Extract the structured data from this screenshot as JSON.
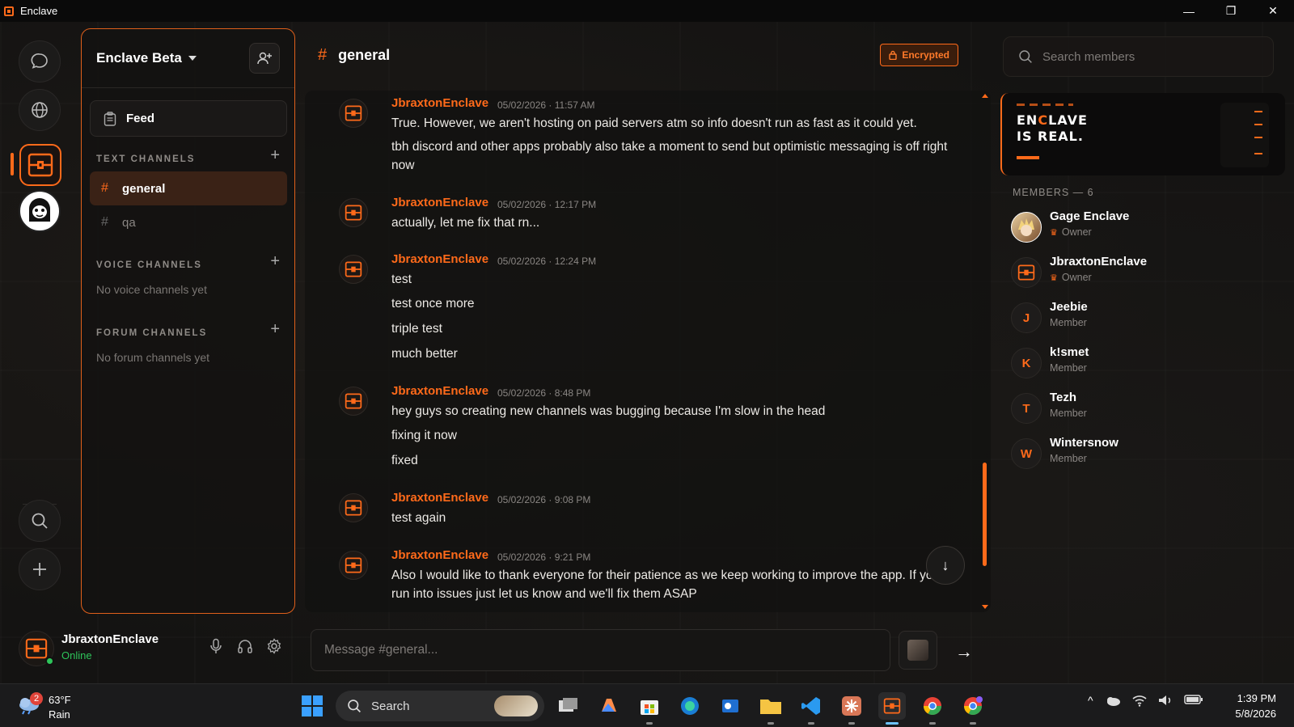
{
  "window": {
    "title": "Enclave"
  },
  "window_controls": {
    "minimize": "—",
    "restore": "❐",
    "close": "✕"
  },
  "server": {
    "name": "Enclave Beta",
    "feed_label": "Feed",
    "sections": {
      "text": {
        "title": "TEXT CHANNELS",
        "add": "+"
      },
      "voice": {
        "title": "VOICE CHANNELS",
        "add": "+",
        "empty": "No voice channels yet"
      },
      "forum": {
        "title": "FORUM CHANNELS",
        "add": "+",
        "empty": "No forum channels yet"
      }
    },
    "text_channels": [
      {
        "hash": "#",
        "name": "general",
        "active": true
      },
      {
        "hash": "#",
        "name": "qa",
        "active": false
      }
    ]
  },
  "current_user": {
    "name": "JbraxtonEnclave",
    "status": "Online"
  },
  "chat": {
    "channel_hash": "#",
    "channel_name": "general",
    "encrypted_label": "Encrypted",
    "jump_icon": "↓",
    "composer_placeholder": "Message #general...",
    "send_icon": "→",
    "messages": [
      {
        "author": "JbraxtonEnclave",
        "time": "05/02/2026 · 11:57 AM",
        "lines": [
          "True. However, we aren't hosting on paid servers atm so info doesn't run as fast as it could yet.",
          "tbh discord and other apps probably also take a moment to send but optimistic messaging is off right now"
        ]
      },
      {
        "author": "JbraxtonEnclave",
        "time": "05/02/2026 · 12:17 PM",
        "lines": [
          "actually, let me fix that rn..."
        ]
      },
      {
        "author": "JbraxtonEnclave",
        "time": "05/02/2026 · 12:24 PM",
        "lines": [
          "test",
          "test once more",
          "triple test",
          "much better"
        ]
      },
      {
        "author": "JbraxtonEnclave",
        "time": "05/02/2026 · 8:48 PM",
        "lines": [
          "hey guys so creating new channels was bugging because I'm slow in the head",
          "fixing it now",
          "fixed"
        ]
      },
      {
        "author": "JbraxtonEnclave",
        "time": "05/02/2026 · 9:08 PM",
        "lines": [
          "test again"
        ]
      },
      {
        "author": "JbraxtonEnclave",
        "time": "05/02/2026 · 9:21 PM",
        "lines": [
          "Also I would like to thank everyone for their patience as we keep working to improve the app. If you run into issues just let us know and we'll fix them ASAP"
        ]
      }
    ]
  },
  "members": {
    "search_placeholder": "Search members",
    "banner": {
      "line1_a": "EN",
      "line1_o": "C",
      "line1_b": "LAVE",
      "line2": "IS REAL."
    },
    "title": "MEMBERS — 6",
    "list": [
      {
        "name": "Gage Enclave",
        "role": "Owner",
        "initial": "",
        "owner": true
      },
      {
        "name": "JbraxtonEnclave",
        "role": "Owner",
        "initial": "",
        "owner": true
      },
      {
        "name": "Jeebie",
        "role": "Member",
        "initial": "J",
        "owner": false
      },
      {
        "name": "k!smet",
        "role": "Member",
        "initial": "K",
        "owner": false
      },
      {
        "name": "Tezh",
        "role": "Member",
        "initial": "T",
        "owner": false
      },
      {
        "name": "Wintersnow",
        "role": "Member",
        "initial": "W",
        "owner": false
      }
    ]
  },
  "taskbar": {
    "weather": {
      "badge": "2",
      "temp": "63°F",
      "condition": "Rain"
    },
    "search_label": "Search",
    "clock_time": "1:39 PM",
    "clock_date": "5/8/2026",
    "tray_chevron": "^"
  },
  "colors": {
    "accent": "#ff6a1a",
    "online": "#2ec45a",
    "background": "#121110"
  }
}
